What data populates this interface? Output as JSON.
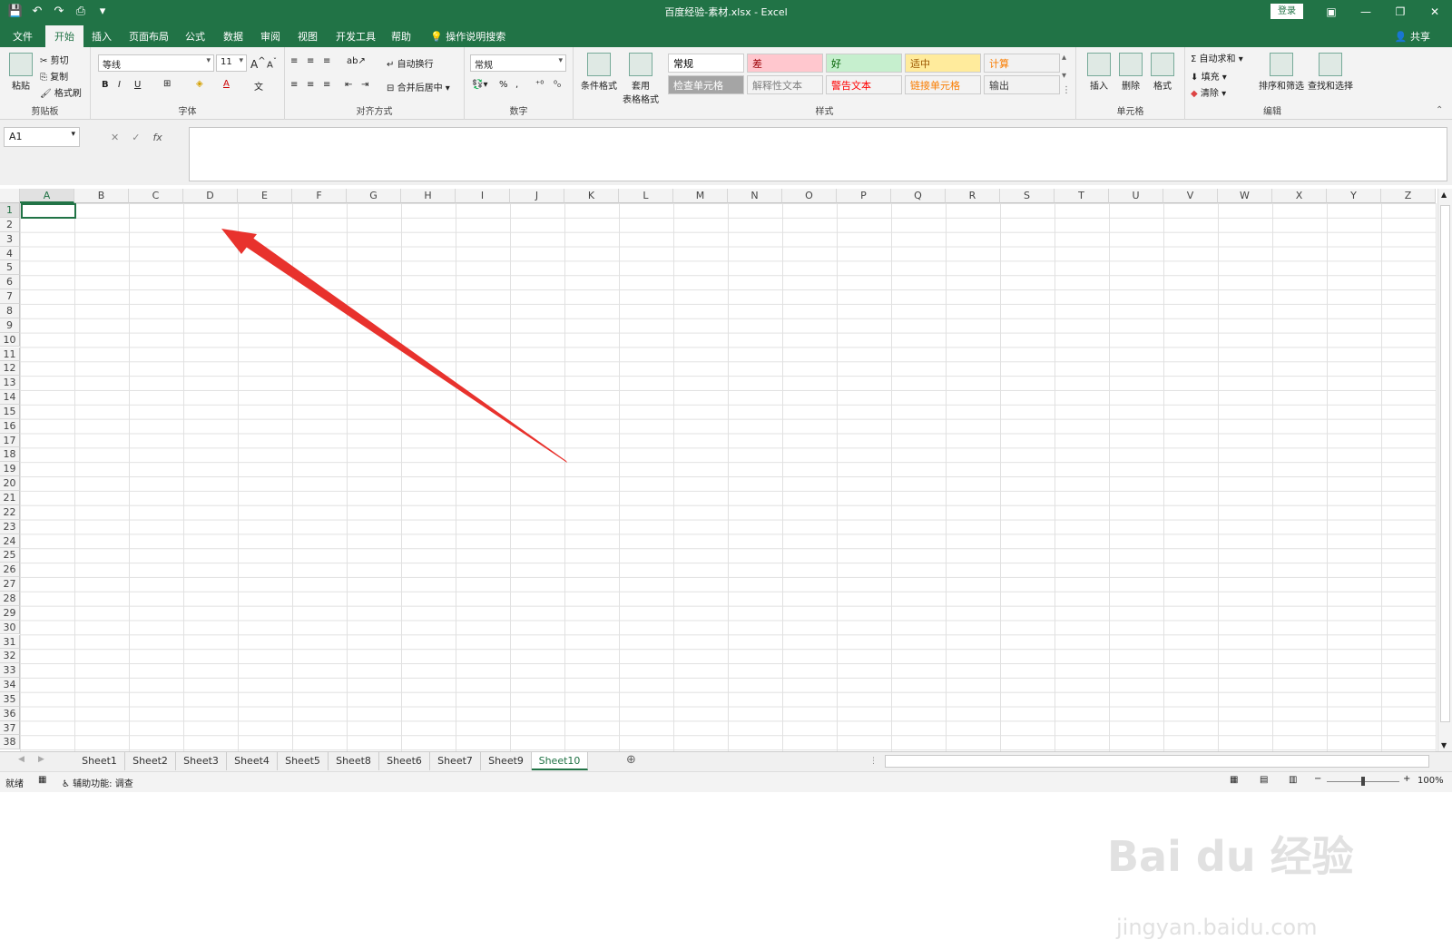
{
  "window": {
    "title": "百度经验-素材.xlsx  -  Excel",
    "login_label": "登录",
    "share_label": "共享"
  },
  "tabs": [
    {
      "label": "文件"
    },
    {
      "label": "开始"
    },
    {
      "label": "插入"
    },
    {
      "label": "页面布局"
    },
    {
      "label": "公式"
    },
    {
      "label": "数据"
    },
    {
      "label": "审阅"
    },
    {
      "label": "视图"
    },
    {
      "label": "开发工具"
    },
    {
      "label": "帮助"
    },
    {
      "label": "操作说明搜索"
    }
  ],
  "ribbon": {
    "clipboard": {
      "paste": "粘贴",
      "cut": "剪切",
      "copy": "复制",
      "format_painter": "格式刷",
      "group_label": "剪贴板"
    },
    "font": {
      "font_name": "等线",
      "font_size": "11",
      "bold": "B",
      "italic": "I",
      "underline": "U",
      "group_label": "字体"
    },
    "alignment": {
      "wrap_text": "自动换行",
      "merge_center": "合并后居中",
      "group_label": "对齐方式"
    },
    "number": {
      "format": "常规",
      "group_label": "数字"
    },
    "styles": {
      "conditional": "条件格式",
      "table_format_1": "套用",
      "table_format_2": "表格格式",
      "cells": [
        {
          "label": "常规",
          "bg": "#ffffff",
          "fg": "#000000"
        },
        {
          "label": "差",
          "bg": "#ffc7ce",
          "fg": "#9c0006"
        },
        {
          "label": "好",
          "bg": "#c6efce",
          "fg": "#006100"
        },
        {
          "label": "适中",
          "bg": "#ffeb9c",
          "fg": "#9c5700"
        },
        {
          "label": "计算",
          "bg": "#f2f2f2",
          "fg": "#fa7d00"
        },
        {
          "label": "检查单元格",
          "bg": "#a5a5a5",
          "fg": "#ffffff"
        },
        {
          "label": "解释性文本",
          "bg": "#f3f3f3",
          "fg": "#7f7f7f"
        },
        {
          "label": "警告文本",
          "bg": "#f3f3f3",
          "fg": "#ff0000"
        },
        {
          "label": "链接单元格",
          "bg": "#f3f3f3",
          "fg": "#fa7d00"
        },
        {
          "label": "输出",
          "bg": "#f2f2f2",
          "fg": "#3f3f3f"
        }
      ],
      "group_label": "样式"
    },
    "cells_group": {
      "insert": "插入",
      "delete": "删除",
      "format": "格式",
      "group_label": "单元格"
    },
    "editing": {
      "autosum": "自动求和",
      "fill": "填充",
      "clear": "清除",
      "sort_filter": "排序和筛选",
      "find_select": "查找和选择",
      "group_label": "编辑"
    }
  },
  "formula_bar": {
    "name_box": "A1",
    "fx": "fx",
    "value": ""
  },
  "columns": [
    "A",
    "B",
    "C",
    "D",
    "E",
    "F",
    "G",
    "H",
    "I",
    "J",
    "K",
    "L",
    "M",
    "N",
    "O",
    "P",
    "Q",
    "R",
    "S",
    "T",
    "U",
    "V",
    "W",
    "X",
    "Y",
    "Z"
  ],
  "rows": [
    "1",
    "2",
    "3",
    "4",
    "5",
    "6",
    "7",
    "8",
    "9",
    "10",
    "11",
    "12",
    "13",
    "14",
    "15",
    "16",
    "17",
    "18",
    "19",
    "20",
    "21",
    "22",
    "23",
    "24",
    "25",
    "26",
    "27",
    "28",
    "29",
    "30",
    "31",
    "32",
    "33",
    "34",
    "35",
    "36",
    "37",
    "38"
  ],
  "sheets": [
    {
      "label": "Sheet1"
    },
    {
      "label": "Sheet2"
    },
    {
      "label": "Sheet3"
    },
    {
      "label": "Sheet4"
    },
    {
      "label": "Sheet5"
    },
    {
      "label": "Sheet8"
    },
    {
      "label": "Sheet6"
    },
    {
      "label": "Sheet7"
    },
    {
      "label": "Sheet9"
    },
    {
      "label": "Sheet10"
    }
  ],
  "active_sheet": "Sheet10",
  "status": {
    "ready": "就绪",
    "accessibility": "辅助功能: 调查",
    "zoom": "100%"
  },
  "annotation": {
    "arrow_color": "#e8322d"
  },
  "watermark": {
    "line1": "Bai du 经验",
    "line2": "jingyan.baidu.com"
  }
}
